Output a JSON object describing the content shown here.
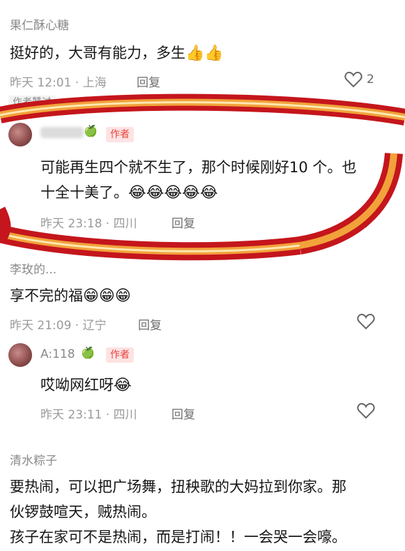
{
  "comments": [
    {
      "username": "果仁酥心糖",
      "text": "挺好的，大哥有能力，多生",
      "emoji": "👍👍",
      "time": "昨天 12:01 · 上海",
      "reply": "回复",
      "likes": "2",
      "tag": "作者赞过"
    },
    {
      "username": "",
      "author_badge": "作者",
      "text_line1": "可能再生四个就不生了，那个时候刚好10 个。也",
      "text_line2": "十全十美了。",
      "emoji": "😂😂😂😂😂",
      "time": "昨天 23:18 · 四川",
      "reply": "回复"
    },
    {
      "username": "李玫的...",
      "text": "享不完的福",
      "emoji": "😁😁😁",
      "time": "昨天 21:09 · 辽宁",
      "reply": "回复"
    },
    {
      "username": "A:118",
      "author_badge": "作者",
      "text": "哎呦网红呀",
      "emoji": "😂",
      "time": "昨天 23:11 · 四川",
      "reply": "回复"
    },
    {
      "username": "清水粽子",
      "text_line1": "要热闹，可以把广场舞，扭秧歌的大妈拉到你家。那",
      "text_line2": "伙锣鼓喧天，贼热闹。",
      "text_line3": "孩子在家可不是热闹，而是打闹！！一会哭一会嚎。"
    }
  ],
  "icons": {
    "heart": "heart-outline-icon",
    "apple": "green-apple-icon"
  },
  "colors": {
    "highlight_outer": "#c4161c",
    "highlight_mid": "#f2a23a",
    "badge_bg": "#fde3e3",
    "badge_text": "#e8453c"
  }
}
